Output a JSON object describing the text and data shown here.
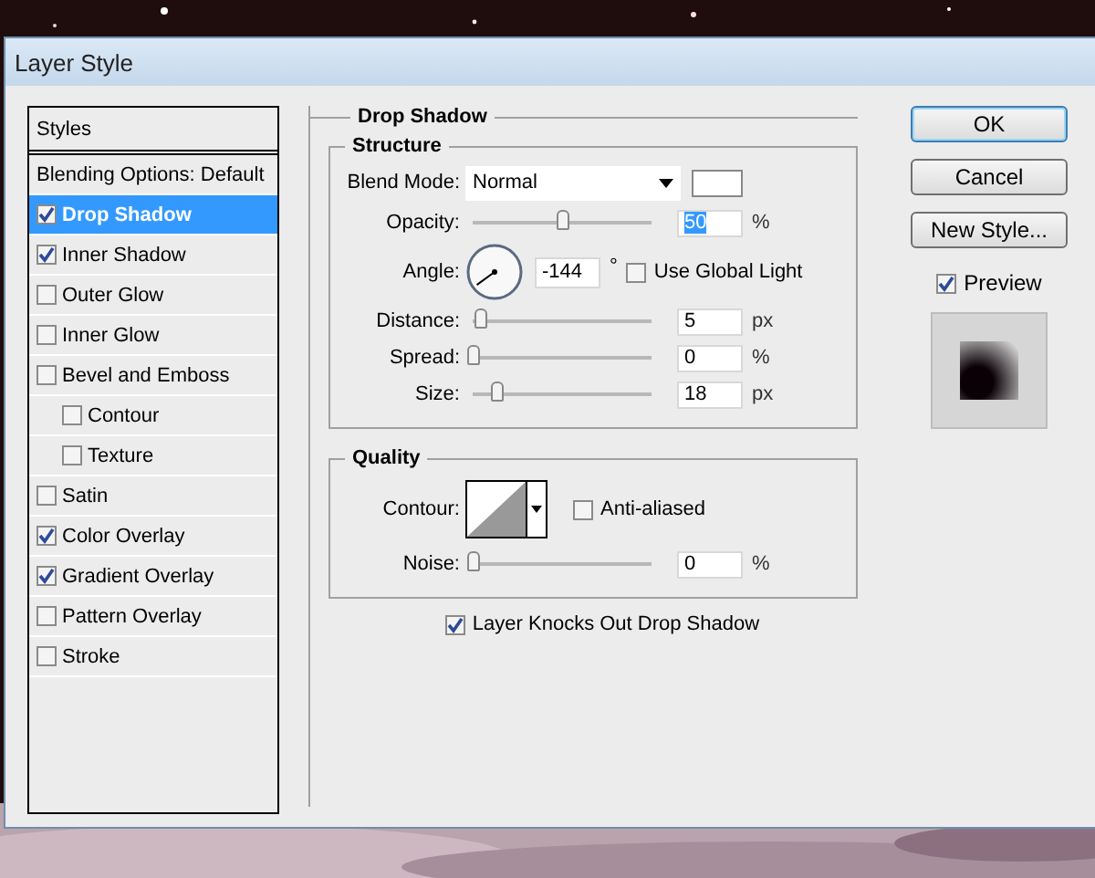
{
  "window": {
    "title": "Layer Style"
  },
  "styles_list": {
    "header": "Styles",
    "items": [
      {
        "label": "Blending Options: Default",
        "kind": "plain",
        "selected": false
      },
      {
        "label": "Drop Shadow",
        "kind": "check",
        "checked": true,
        "selected": true
      },
      {
        "label": "Inner Shadow",
        "kind": "check",
        "checked": true,
        "selected": false
      },
      {
        "label": "Outer Glow",
        "kind": "check",
        "checked": false,
        "selected": false
      },
      {
        "label": "Inner Glow",
        "kind": "check",
        "checked": false,
        "selected": false
      },
      {
        "label": "Bevel and Emboss",
        "kind": "check",
        "checked": false,
        "selected": false,
        "children": [
          {
            "label": "Contour",
            "kind": "check",
            "checked": false,
            "selected": false
          },
          {
            "label": "Texture",
            "kind": "check",
            "checked": false,
            "selected": false
          }
        ]
      },
      {
        "label": "Satin",
        "kind": "check",
        "checked": false,
        "selected": false
      },
      {
        "label": "Color Overlay",
        "kind": "check",
        "checked": true,
        "selected": false
      },
      {
        "label": "Gradient Overlay",
        "kind": "check",
        "checked": true,
        "selected": false
      },
      {
        "label": "Pattern Overlay",
        "kind": "check",
        "checked": false,
        "selected": false
      },
      {
        "label": "Stroke",
        "kind": "check",
        "checked": false,
        "selected": false
      }
    ]
  },
  "panel": {
    "title": "Drop Shadow",
    "structure": {
      "title": "Structure",
      "blend_mode": {
        "label": "Blend Mode:",
        "value": "Normal"
      },
      "opacity": {
        "label": "Opacity:",
        "level": 0.5,
        "value": "50",
        "text_selected": true,
        "unit": "%"
      },
      "angle": {
        "label": "Angle:",
        "value": "-144",
        "unit": "°",
        "use_global_light": {
          "label": "Use Global Light",
          "checked": false
        }
      },
      "sliders": [
        {
          "label": "Distance:",
          "level": 0.04,
          "value": "5",
          "unit": "px"
        },
        {
          "label": "Spread:",
          "level": 0,
          "value": "0",
          "unit": "%"
        },
        {
          "label": "Size:",
          "level": 0.13,
          "value": "18",
          "unit": "px"
        }
      ]
    },
    "quality": {
      "title": "Quality",
      "contour": {
        "label": "Contour:"
      },
      "anti_aliased": {
        "label": "Anti-aliased",
        "checked": false
      },
      "noise": {
        "label": "Noise:",
        "level": 0,
        "value": "0",
        "unit": "%"
      }
    },
    "knockout": {
      "label": "Layer Knocks Out Drop Shadow",
      "checked": true
    }
  },
  "buttons": [
    {
      "label": "OK",
      "default": true
    },
    {
      "label": "Cancel",
      "default": false
    },
    {
      "label": "New Style...",
      "default": false
    }
  ],
  "preview": {
    "label": "Preview",
    "checked": true
  }
}
